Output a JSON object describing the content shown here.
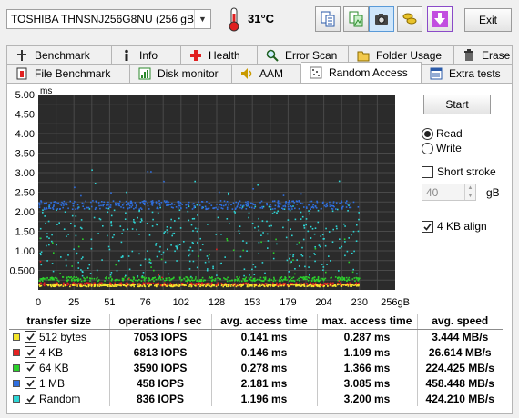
{
  "toolbar": {
    "drive": "TOSHIBA THNSNJ256G8NU (256 gB)",
    "temperature": "31°C",
    "exit_label": "Exit"
  },
  "tabs_row1": [
    {
      "label": "Benchmark",
      "icon": "benchmark-icon"
    },
    {
      "label": "Info",
      "icon": "info-icon"
    },
    {
      "label": "Health",
      "icon": "health-icon"
    },
    {
      "label": "Error Scan",
      "icon": "error-scan-icon"
    },
    {
      "label": "Folder Usage",
      "icon": "folder-icon"
    },
    {
      "label": "Erase",
      "icon": "erase-icon"
    }
  ],
  "tabs_row2": [
    {
      "label": "File Benchmark",
      "icon": "file-benchmark-icon"
    },
    {
      "label": "Disk monitor",
      "icon": "disk-monitor-icon"
    },
    {
      "label": "AAM",
      "icon": "speaker-icon"
    },
    {
      "label": "Random Access",
      "icon": "random-access-icon",
      "selected": true
    },
    {
      "label": "Extra tests",
      "icon": "extra-tests-icon"
    }
  ],
  "controls": {
    "start_label": "Start",
    "read_label": "Read",
    "write_label": "Write",
    "mode_selected": "Read",
    "short_stroke_label": "Short stroke",
    "short_stroke_checked": false,
    "short_stroke_value": "40",
    "short_stroke_unit": "gB",
    "align_label": "4 KB align",
    "align_checked": true
  },
  "chart_data": {
    "type": "scatter",
    "ylabel": "ms",
    "y_ticks": [
      "5.00",
      "4.50",
      "4.00",
      "3.50",
      "3.00",
      "2.50",
      "2.00",
      "1.50",
      "1.00",
      "0.500"
    ],
    "x_ticks": [
      "0",
      "25",
      "51",
      "76",
      "102",
      "128",
      "153",
      "179",
      "204",
      "230",
      "256gB"
    ],
    "xlim": [
      0,
      256
    ],
    "ylim": [
      0,
      5
    ],
    "grid": true,
    "background": "#2b2b2b",
    "series": [
      {
        "name": "512 bytes",
        "color": "#f5e62a",
        "typical_ms": 0.141,
        "max_ms": 0.287
      },
      {
        "name": "4 KB",
        "color": "#e42121",
        "typical_ms": 0.146,
        "max_ms": 1.109
      },
      {
        "name": "64 KB",
        "color": "#2bd12b",
        "typical_ms": 0.278,
        "max_ms": 1.366
      },
      {
        "name": "1 MB",
        "color": "#2f6fe0",
        "typical_ms": 2.181,
        "max_ms": 3.085
      },
      {
        "name": "Random",
        "color": "#2ed6d6",
        "typical_ms": 1.196,
        "max_ms": 3.2
      }
    ]
  },
  "table": {
    "headers": [
      "transfer size",
      "operations / sec",
      "avg. access time",
      "max. access time",
      "avg. speed"
    ],
    "rows": [
      {
        "size": "512 bytes",
        "color": "#f5e62a",
        "ops": "7053 IOPS",
        "avg": "0.141 ms",
        "max": "0.287 ms",
        "speed": "3.444 MB/s"
      },
      {
        "size": "4 KB",
        "color": "#e42121",
        "ops": "6813 IOPS",
        "avg": "0.146 ms",
        "max": "1.109 ms",
        "speed": "26.614 MB/s"
      },
      {
        "size": "64 KB",
        "color": "#2bd12b",
        "ops": "3590 IOPS",
        "avg": "0.278 ms",
        "max": "1.366 ms",
        "speed": "224.425 MB/s"
      },
      {
        "size": "1 MB",
        "color": "#2f6fe0",
        "ops": "458 IOPS",
        "avg": "2.181 ms",
        "max": "3.085 ms",
        "speed": "458.448 MB/s"
      },
      {
        "size": "Random",
        "color": "#2ed6d6",
        "ops": "836 IOPS",
        "avg": "1.196 ms",
        "max": "3.200 ms",
        "speed": "424.210 MB/s"
      }
    ]
  }
}
